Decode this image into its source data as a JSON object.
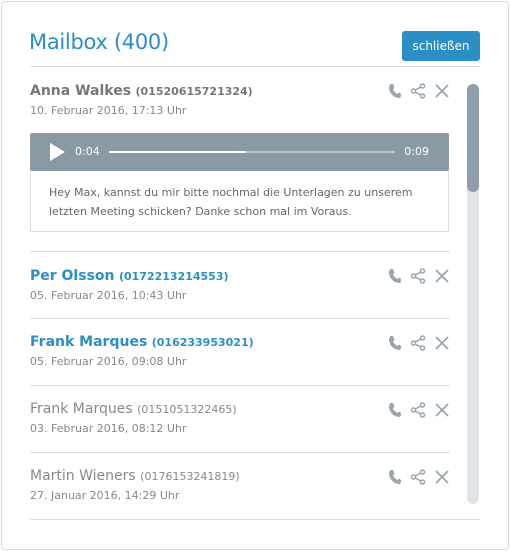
{
  "header": {
    "title": "Mailbox (400)",
    "close_label": "schließen"
  },
  "player": {
    "current": "0:04",
    "total": "0:09",
    "progress": 0.48
  },
  "messages": [
    {
      "name": "Anna Walkes",
      "number": "(01520615721324)",
      "date": "10. Februar 2016, 17:13 Uhr",
      "state": "default",
      "transcript": "Hey Max, kannst du mir bitte nochmal die Unterlagen zu unserem letzten Meeting schicken? Danke schon mal im Voraus."
    },
    {
      "name": "Per Olsson",
      "number": "(0172213214553)",
      "date": "05. Februar 2016, 10:43 Uhr",
      "state": "unread"
    },
    {
      "name": "Frank Marques",
      "number": "(016233953021)",
      "date": "05. Februar 2016, 09:08 Uhr",
      "state": "unread"
    },
    {
      "name": "Frank Marques",
      "number": "(0151051322465)",
      "date": "03. Februar 2016, 08:12 Uhr",
      "state": "read"
    },
    {
      "name": "Martin Wieners",
      "number": "(0176153241819)",
      "date": "27. Januar 2016, 14:29 Uhr",
      "state": "read"
    }
  ],
  "icons": {
    "call": "phone-icon",
    "share": "share-icon",
    "delete": "close-icon"
  },
  "colors": {
    "accent": "#2b8fc6",
    "player": "#8a9aa5",
    "scroll_thumb": "#8f9ea9"
  }
}
